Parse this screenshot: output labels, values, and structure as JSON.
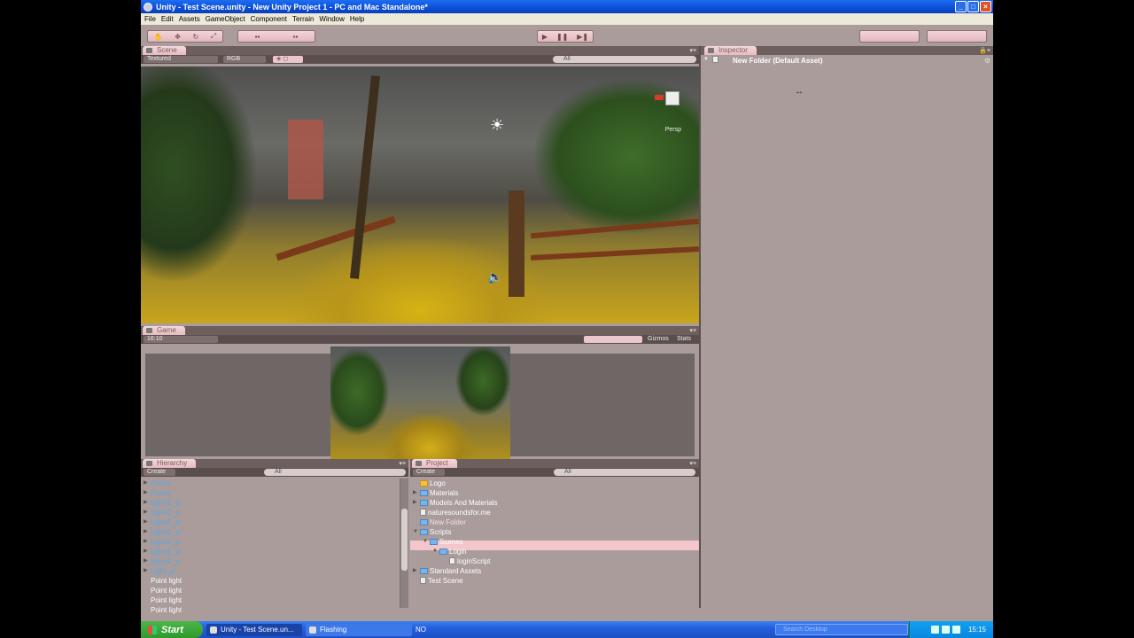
{
  "window": {
    "title": "Unity - Test Scene.unity - New Unity Project 1 - PC and Mac Standalone*",
    "controls": [
      "_",
      "□",
      "×"
    ]
  },
  "menu": [
    "File",
    "Edit",
    "Assets",
    "GameObject",
    "Component",
    "Terrain",
    "Window",
    "Help"
  ],
  "scene": {
    "tab": "Scene",
    "draw_mode": "Textured",
    "render_mode": "RGB",
    "search": "All",
    "gizmo_label": "Persp"
  },
  "game": {
    "tab": "Game",
    "aspect": "16:10",
    "gizmos": "Gizmos",
    "stats": "Stats"
  },
  "hierarchy": {
    "tab": "Hierarchy",
    "create": "Create",
    "search": "All",
    "items": [
      {
        "label": "Fence",
        "prefab": true,
        "expandable": true
      },
      {
        "label": "Fence",
        "prefab": true,
        "expandable": true
      },
      {
        "label": "tyjjhn2_yr",
        "prefab": true,
        "expandable": true
      },
      {
        "label": "tyjjhn2_yr",
        "prefab": true,
        "expandable": true
      },
      {
        "label": "tyjjhn2_yr",
        "prefab": true,
        "expandable": true
      },
      {
        "label": "tyjjhn2_yr",
        "prefab": true,
        "expandable": true
      },
      {
        "label": "tyjjhn2_yr",
        "prefab": true,
        "expandable": true
      },
      {
        "label": "tyjjhn2_yr",
        "prefab": true,
        "expandable": true
      },
      {
        "label": "tyjjhn2_yr",
        "prefab": true,
        "expandable": true
      },
      {
        "label": "Light_yr",
        "prefab": true,
        "expandable": true
      },
      {
        "label": "Point light",
        "prefab": false,
        "expandable": false
      },
      {
        "label": "Point light",
        "prefab": false,
        "expandable": false
      },
      {
        "label": "Point light",
        "prefab": false,
        "expandable": false
      },
      {
        "label": "Point light",
        "prefab": false,
        "expandable": false
      }
    ]
  },
  "project": {
    "tab": "Project",
    "create": "Create",
    "search": "All",
    "items": [
      {
        "label": "Logo",
        "indent": 0,
        "icon": "folder-yellow",
        "arrow": ""
      },
      {
        "label": "Materials",
        "indent": 0,
        "icon": "folder",
        "arrow": "▶"
      },
      {
        "label": "Models And Materials",
        "indent": 0,
        "icon": "folder",
        "arrow": "▶"
      },
      {
        "label": "naturesoundsfor.me",
        "indent": 0,
        "icon": "audio",
        "arrow": ""
      },
      {
        "label": "New Folder",
        "indent": 0,
        "icon": "folder",
        "arrow": "",
        "selected": true
      },
      {
        "label": "Scripts",
        "indent": 0,
        "icon": "folder",
        "arrow": "▼"
      },
      {
        "label": "Scenes",
        "indent": 1,
        "icon": "folder",
        "arrow": "▼"
      },
      {
        "label": "Login",
        "indent": 2,
        "icon": "folder",
        "arrow": "▼"
      },
      {
        "label": "loginScript",
        "indent": 3,
        "icon": "file",
        "arrow": ""
      },
      {
        "label": "Standard Assets",
        "indent": 0,
        "icon": "folder",
        "arrow": "▶"
      },
      {
        "label": "Test Scene",
        "indent": 0,
        "icon": "scene",
        "arrow": ""
      }
    ]
  },
  "inspector": {
    "tab": "Inspector",
    "title": "New Folder (Default Asset)"
  },
  "taskbar": {
    "start": "Start",
    "tasks": [
      "Unity - Test Scene.un...",
      "Flashing"
    ],
    "language": "NO",
    "search_placeholder": "Search Desktop",
    "clock": "15:15"
  }
}
